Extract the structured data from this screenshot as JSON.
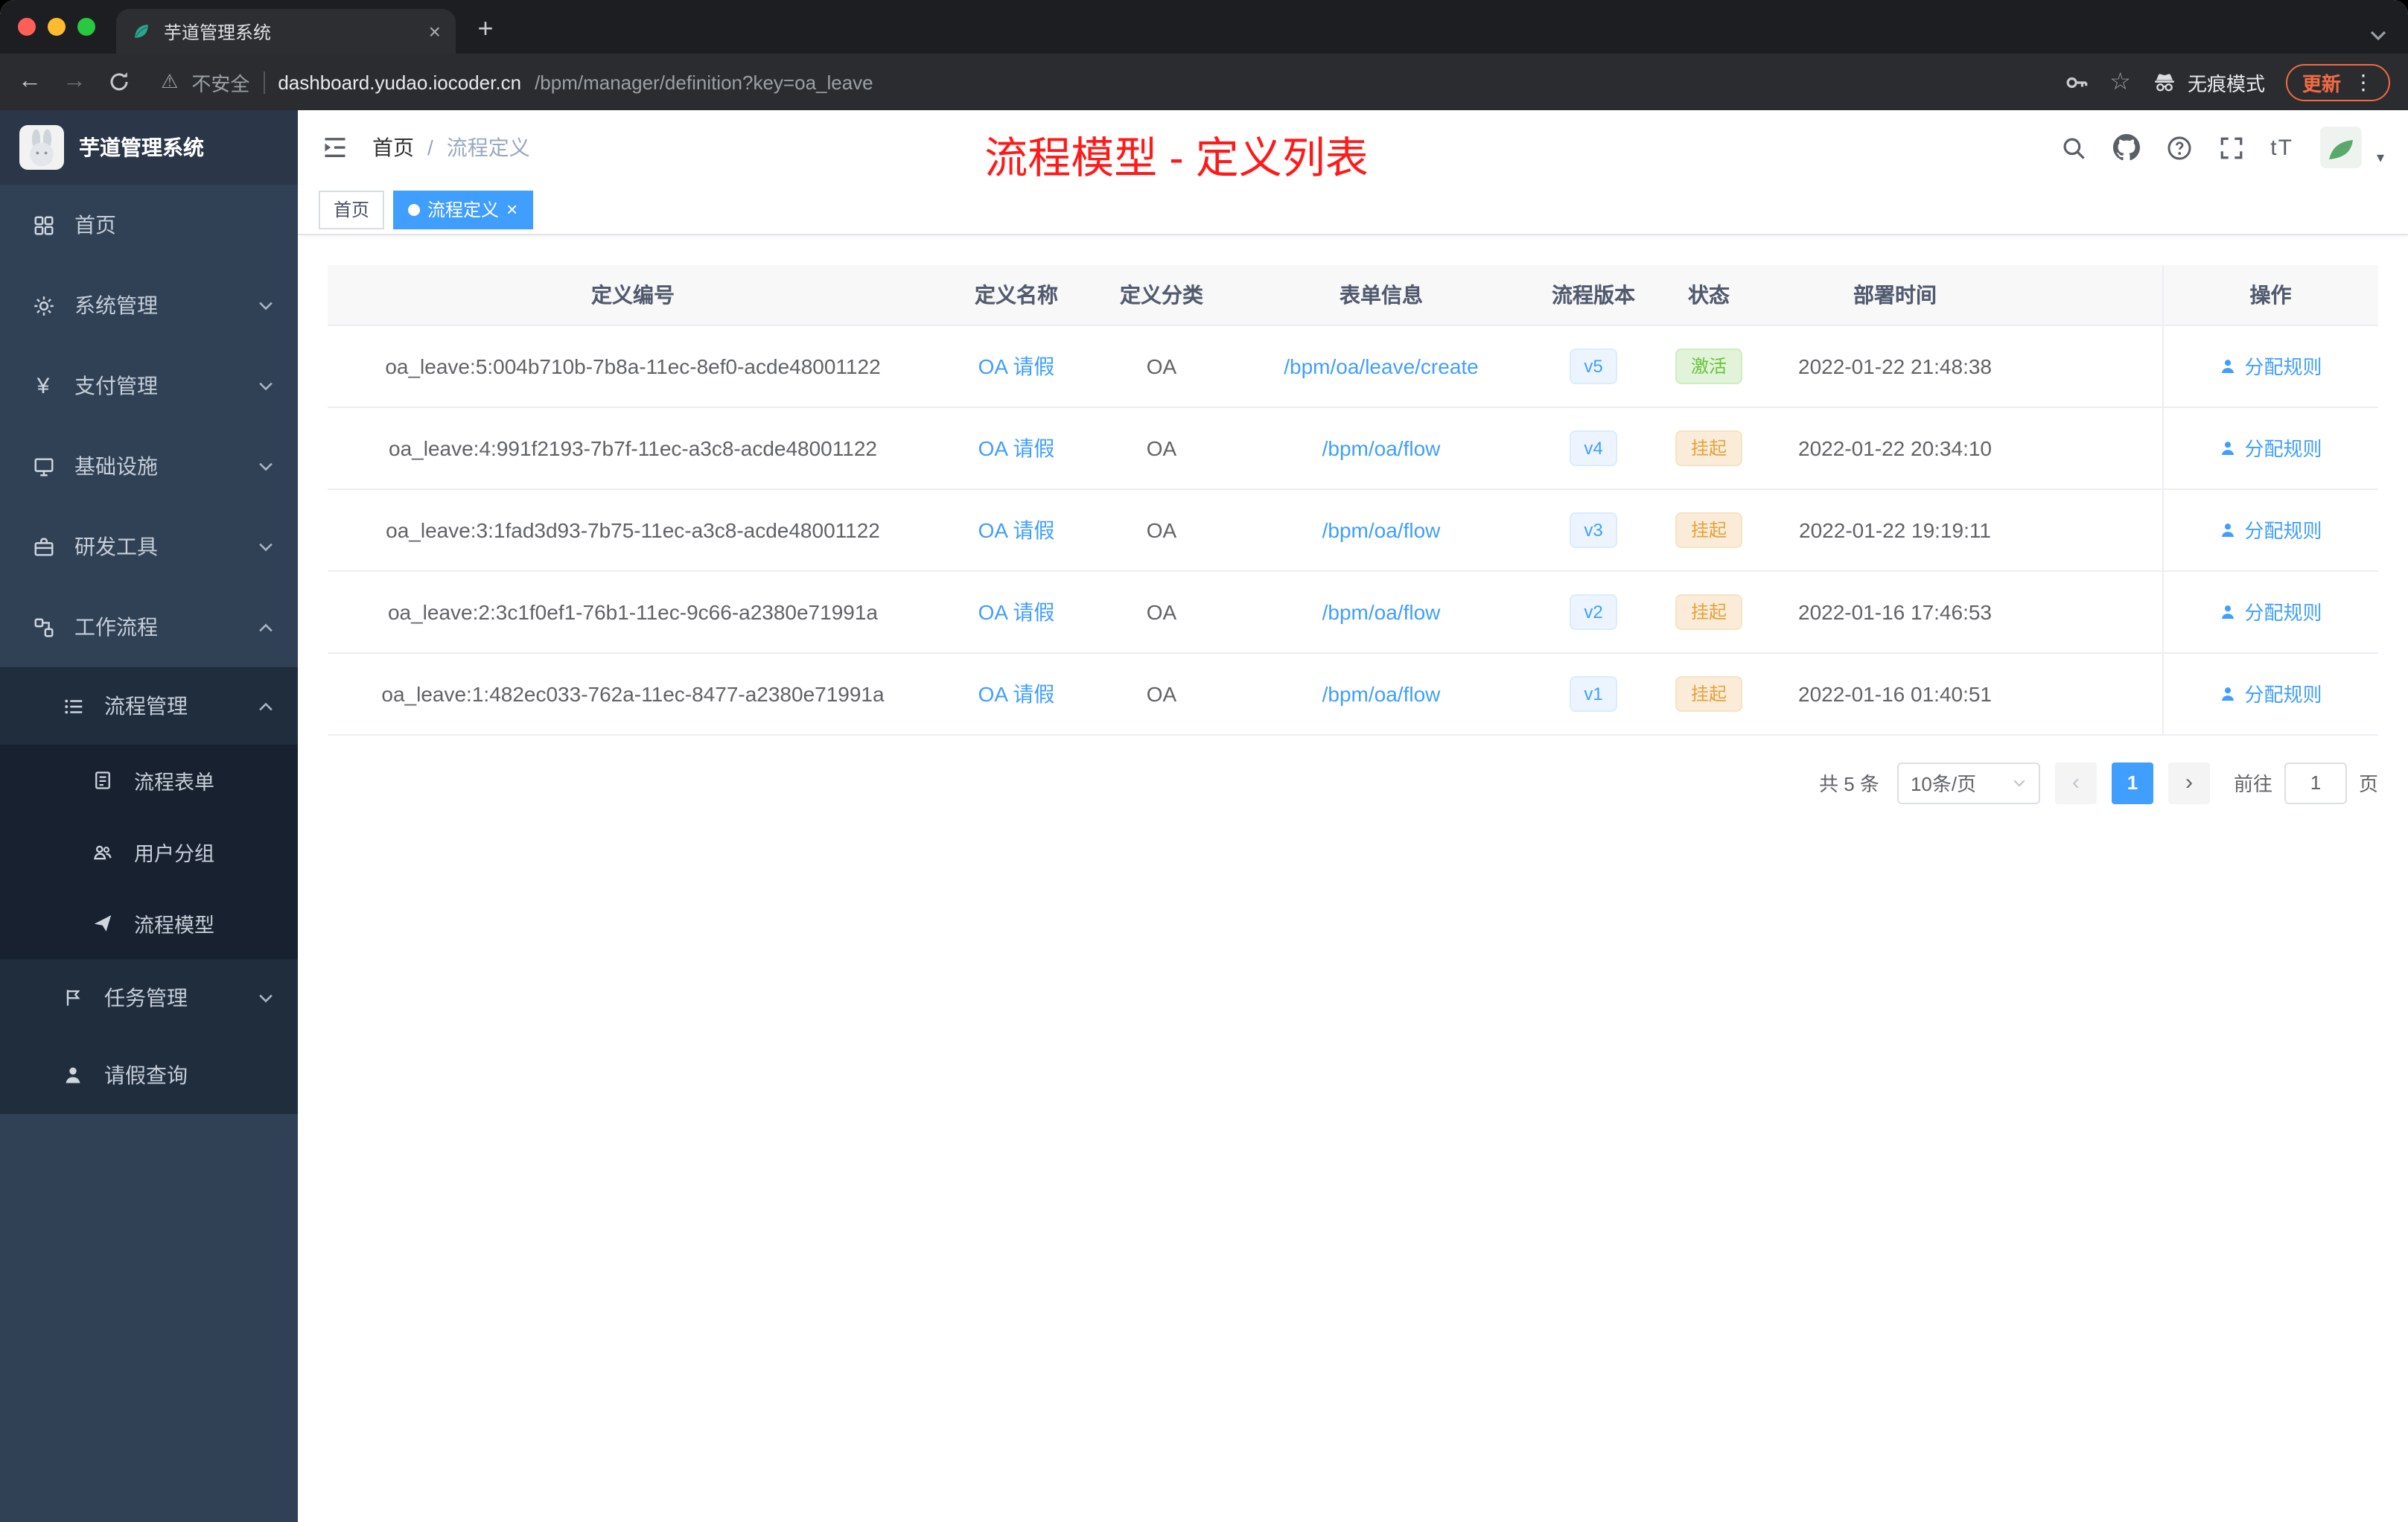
{
  "browser": {
    "tab_title": "芋道管理系统",
    "new_tab": "+",
    "security_label": "不安全",
    "url_domain": "dashboard.yudao.iocoder.cn",
    "url_path": "/bpm/manager/definition?key=oa_leave",
    "incognito_label": "无痕模式",
    "update_label": "更新"
  },
  "sidebar": {
    "logo_title": "芋道管理系统",
    "items": [
      {
        "label": "首页"
      },
      {
        "label": "系统管理"
      },
      {
        "label": "支付管理"
      },
      {
        "label": "基础设施"
      },
      {
        "label": "研发工具"
      },
      {
        "label": "工作流程"
      },
      {
        "label": "流程管理"
      },
      {
        "label": "流程表单"
      },
      {
        "label": "用户分组"
      },
      {
        "label": "流程模型"
      },
      {
        "label": "任务管理"
      },
      {
        "label": "请假查询"
      }
    ]
  },
  "header": {
    "breadcrumb_home": "首页",
    "breadcrumb_sep": "/",
    "breadcrumb_current": "流程定义",
    "annotation_title": "流程模型 - 定义列表",
    "annotation_color": "#ff1a1a",
    "font_size_icon_label": "tT"
  },
  "tags": {
    "home": "首页",
    "active": "流程定义"
  },
  "table": {
    "headers": [
      "定义编号",
      "定义名称",
      "定义分类",
      "表单信息",
      "流程版本",
      "状态",
      "部署时间",
      "操作"
    ],
    "rows": [
      {
        "id": "oa_leave:5:004b710b-7b8a-11ec-8ef0-acde48001122",
        "name": "OA 请假",
        "category": "OA",
        "form": "/bpm/oa/leave/create",
        "version": "v5",
        "status": "激活",
        "status_type": "active",
        "deploy_time": "2022-01-22 21:48:38",
        "action": "分配规则"
      },
      {
        "id": "oa_leave:4:991f2193-7b7f-11ec-a3c8-acde48001122",
        "name": "OA 请假",
        "category": "OA",
        "form": "/bpm/oa/flow",
        "version": "v4",
        "status": "挂起",
        "status_type": "suspended",
        "deploy_time": "2022-01-22 20:34:10",
        "action": "分配规则"
      },
      {
        "id": "oa_leave:3:1fad3d93-7b75-11ec-a3c8-acde48001122",
        "name": "OA 请假",
        "category": "OA",
        "form": "/bpm/oa/flow",
        "version": "v3",
        "status": "挂起",
        "status_type": "suspended",
        "deploy_time": "2022-01-22 19:19:11",
        "action": "分配规则"
      },
      {
        "id": "oa_leave:2:3c1f0ef1-76b1-11ec-9c66-a2380e71991a",
        "name": "OA 请假",
        "category": "OA",
        "form": "/bpm/oa/flow",
        "version": "v2",
        "status": "挂起",
        "status_type": "suspended",
        "deploy_time": "2022-01-16 17:46:53",
        "action": "分配规则"
      },
      {
        "id": "oa_leave:1:482ec033-762a-11ec-8477-a2380e71991a",
        "name": "OA 请假",
        "category": "OA",
        "form": "/bpm/oa/flow",
        "version": "v1",
        "status": "挂起",
        "status_type": "suspended",
        "deploy_time": "2022-01-16 01:40:51",
        "action": "分配规则"
      }
    ]
  },
  "pagination": {
    "total": "共 5 条",
    "page_size": "10条/页",
    "prev": "‹",
    "current_page": "1",
    "next": "›",
    "goto_label": "前往",
    "goto_value": "1",
    "goto_suffix": "页"
  },
  "colors": {
    "primary": "#409eff",
    "sidebar_bg": "#304156",
    "status_active_text": "#67c23a",
    "status_suspended_text": "#e6a23c",
    "annotation_red": "#ff1a1a"
  }
}
